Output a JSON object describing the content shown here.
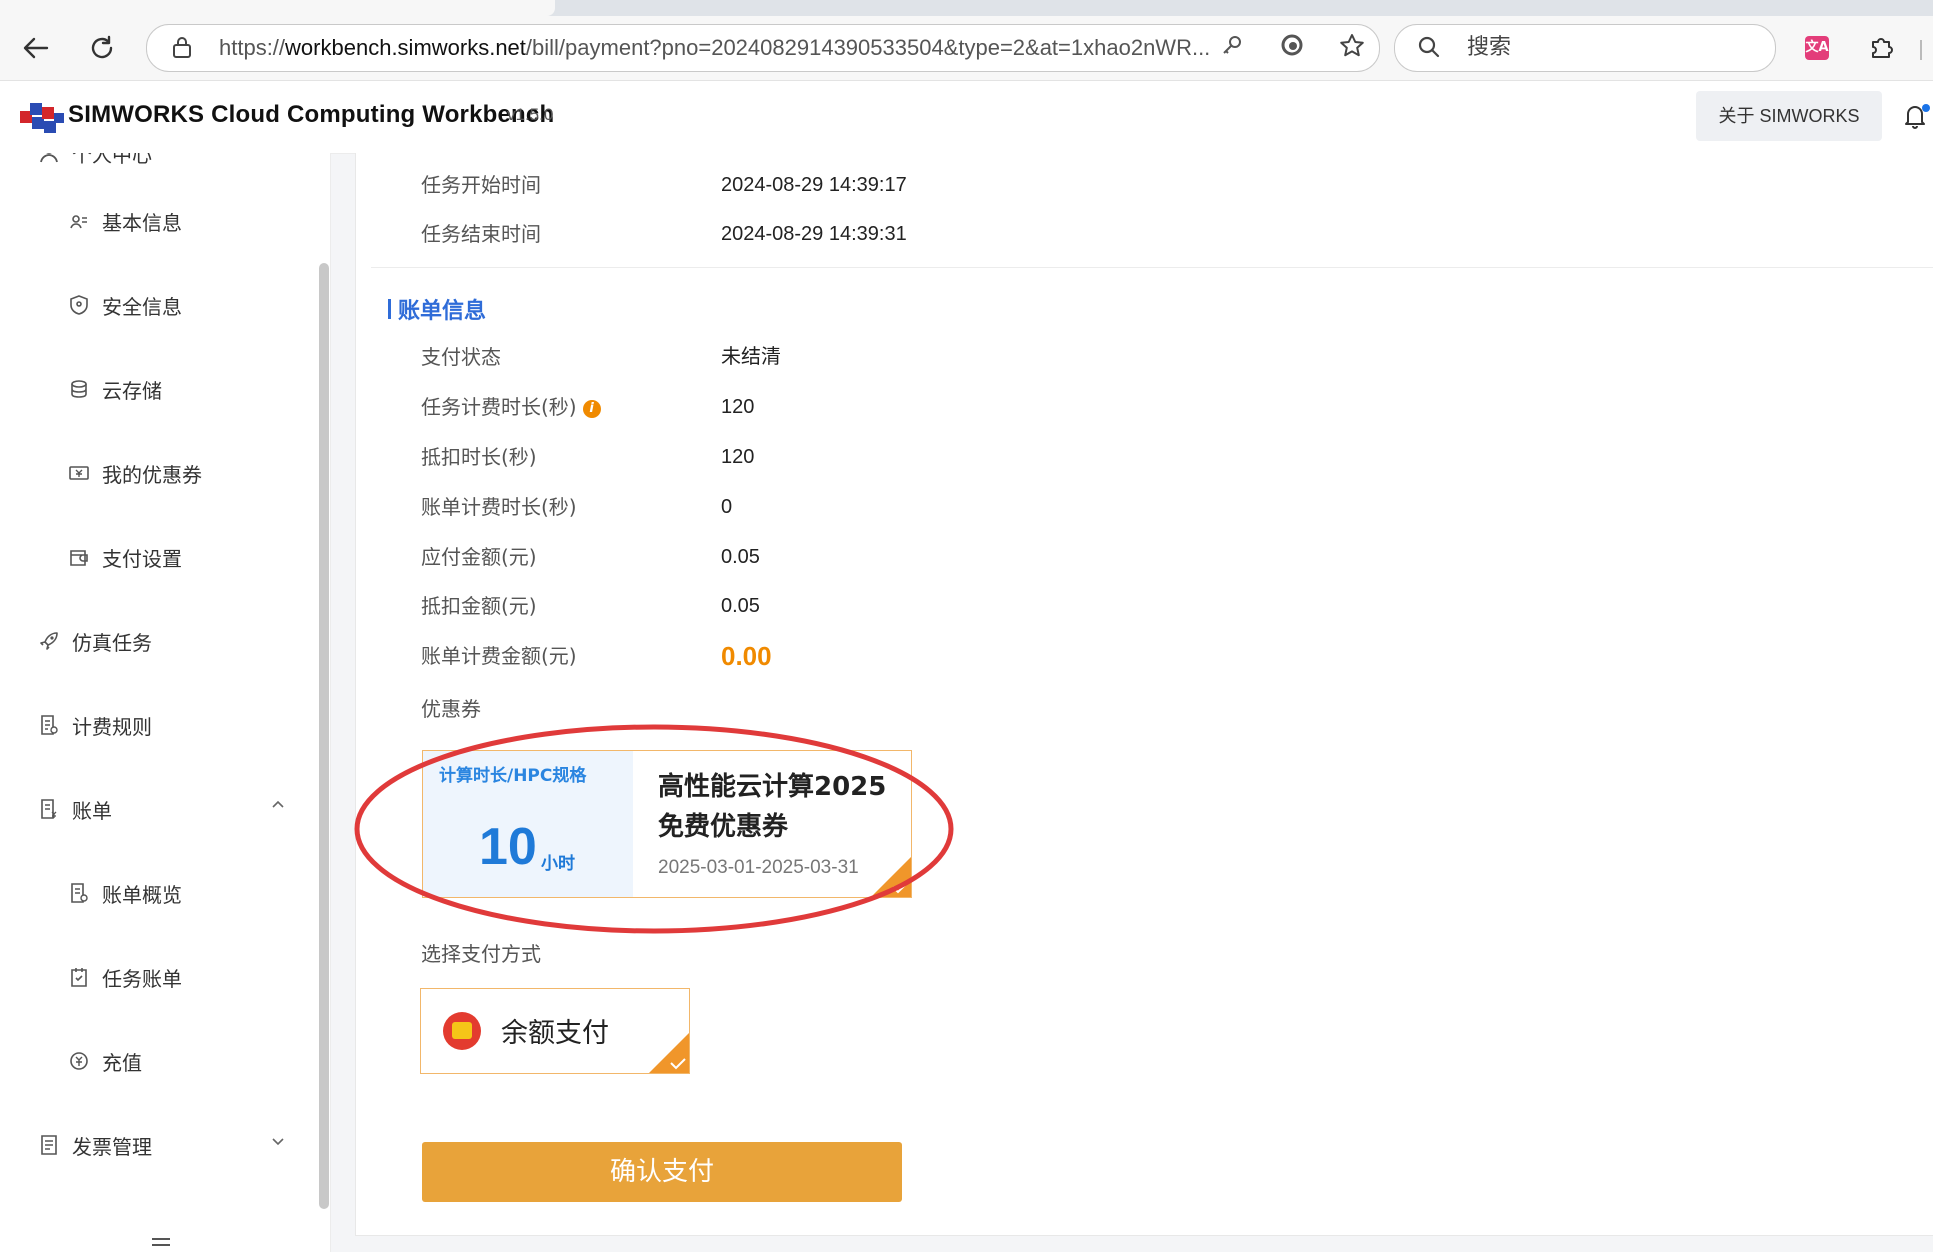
{
  "browser": {
    "url_prefix": "https://",
    "url_domain": "workbench.simworks.net",
    "url_path": "/bill/payment?pno=2024082914390533504&type=2&at=1xhao2nWR...",
    "search_placeholder": "搜索",
    "translate_label": "文A"
  },
  "app": {
    "brand": "SIMWORKS Cloud Computing Workbench",
    "version": "v1.5.0",
    "about_label": "关于 SIMWORKS"
  },
  "sidebar": {
    "items": [
      {
        "label": "个人中心",
        "icon": "user-icon"
      },
      {
        "label": "基本信息",
        "icon": "id-card-icon"
      },
      {
        "label": "安全信息",
        "icon": "shield-icon"
      },
      {
        "label": "云存储",
        "icon": "cloud-storage-icon"
      },
      {
        "label": "我的优惠券",
        "icon": "coupon-icon"
      },
      {
        "label": "支付设置",
        "icon": "wallet-icon"
      },
      {
        "label": "仿真任务",
        "icon": "rocket-icon"
      },
      {
        "label": "计费规则",
        "icon": "document-icon"
      },
      {
        "label": "账单",
        "icon": "bill-icon"
      },
      {
        "label": "账单概览",
        "icon": "bill-overview-icon"
      },
      {
        "label": "任务账单",
        "icon": "task-bill-icon"
      },
      {
        "label": "充值",
        "icon": "recharge-icon"
      },
      {
        "label": "发票管理",
        "icon": "invoice-icon"
      }
    ]
  },
  "task": {
    "start_label": "任务开始时间",
    "start_value": "2024-08-29 14:39:17",
    "end_label": "任务结束时间",
    "end_value": "2024-08-29 14:39:31"
  },
  "bill": {
    "section_title": "账单信息",
    "rows": [
      {
        "label": "支付状态",
        "value": "未结清"
      },
      {
        "label": "任务计费时长(秒)",
        "value": "120"
      },
      {
        "label": "抵扣时长(秒)",
        "value": "120"
      },
      {
        "label": "账单计费时长(秒)",
        "value": "0"
      },
      {
        "label": "应付金额(元)",
        "value": "0.05"
      },
      {
        "label": "抵扣金额(元)",
        "value": "0.05"
      },
      {
        "label": "账单计费金额(元)",
        "value": "0.00"
      }
    ],
    "coupon_label": "优惠券",
    "info_icon": "i"
  },
  "coupon": {
    "spec": "计算时长/HPC规格",
    "amount": "10",
    "unit": "小时",
    "title": "高性能云计算2025免费优惠券",
    "date_range": "2025-03-01-2025-03-31"
  },
  "payment": {
    "method_label": "选择支付方式",
    "method": "余额支付",
    "confirm_label": "确认支付"
  },
  "colors": {
    "accent_blue": "#2f6cd8",
    "accent_orange": "#f08a00",
    "confirm_bg": "#e8a33a",
    "annotation_red": "#e03a3a"
  }
}
